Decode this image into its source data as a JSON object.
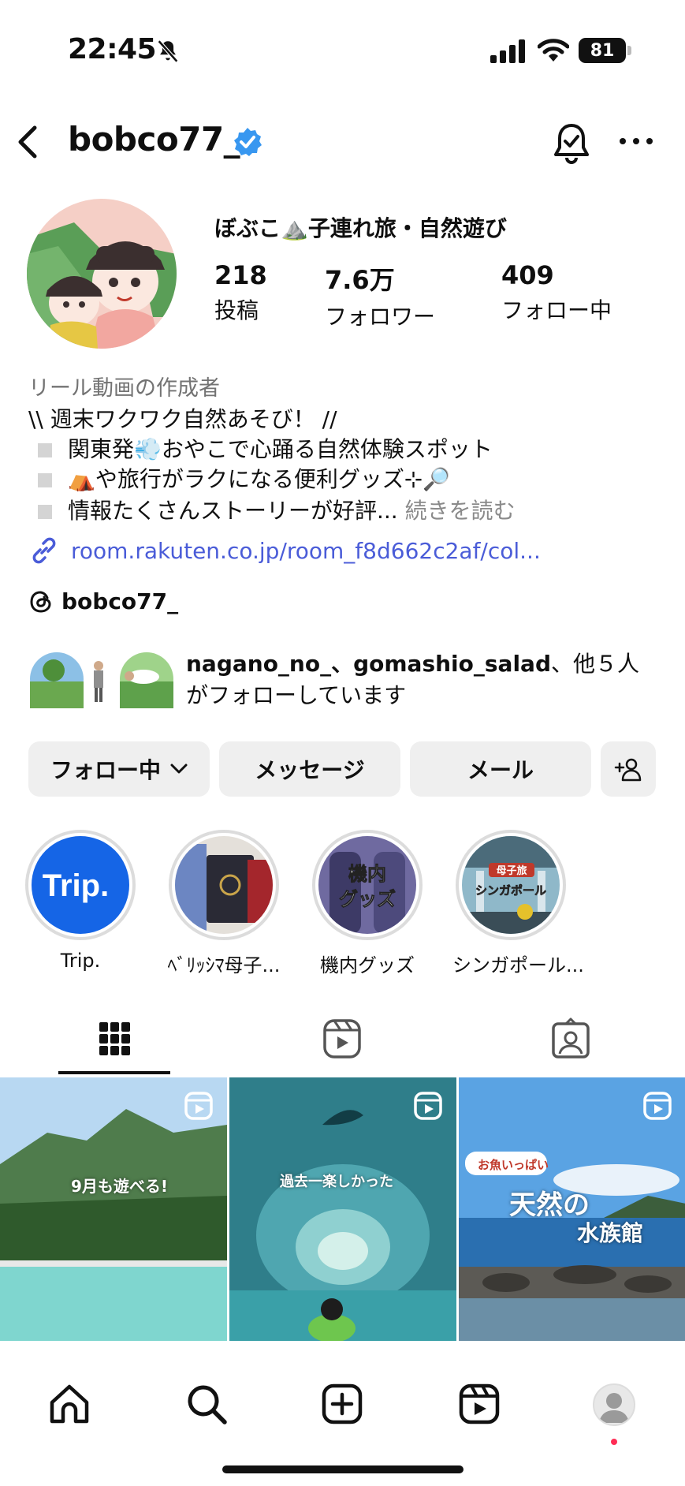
{
  "status_bar": {
    "time": "22:45",
    "battery": "81"
  },
  "header": {
    "username": "bobco77_"
  },
  "profile": {
    "display_name": "ぼぶこ⛰️子連れ旅・自然遊び",
    "stats": [
      {
        "value": "218",
        "label": "投稿"
      },
      {
        "value": "7.6万",
        "label": "フォロワー"
      },
      {
        "value": "409",
        "label": "フォロー中"
      }
    ],
    "category": "リール動画の作成者",
    "bio": {
      "line1": "\\\\ 週末ワクワク自然あそび！ //",
      "line2": "関東発💨おやこで心踊る自然体験スポット",
      "line3": "⛺や旅行がラクになる便利グッズ⊹🔎",
      "line4": "情報たくさんストーリーが好評...",
      "more": "続きを読む"
    },
    "link": "room.rakuten.co.jp/room_f8d662c2af/col...",
    "threads": "bobco77_",
    "mutual": {
      "names": "nagano_no_、gomashio_salad",
      "suffix": "、他５人がフォローしています"
    }
  },
  "buttons": {
    "following": "フォロー中",
    "message": "メッセージ",
    "email": "メール"
  },
  "highlights": [
    {
      "label": "Trip."
    },
    {
      "label": "ﾍﾞﾘｯｼﾏ母子..."
    },
    {
      "label": "機内グッズ"
    },
    {
      "label": "シンガポール..."
    }
  ],
  "highlight_text": {
    "trip_logo": "Trip.",
    "kinai": "機内\nグッズ",
    "singapore_1": "母子旅",
    "singapore_2": "シンガポール"
  },
  "posts": [
    {
      "caption": "9月も遊べる!"
    },
    {
      "caption": "過去一楽しかった"
    },
    {
      "caption_small": "お魚いっぱい",
      "caption_1": "天然の",
      "caption_2": "水族館"
    }
  ],
  "colors": {
    "link": "#4a5cd8",
    "verified": "#3897f0",
    "button_bg": "#efefef",
    "notification_dot": "#ff2d55"
  }
}
